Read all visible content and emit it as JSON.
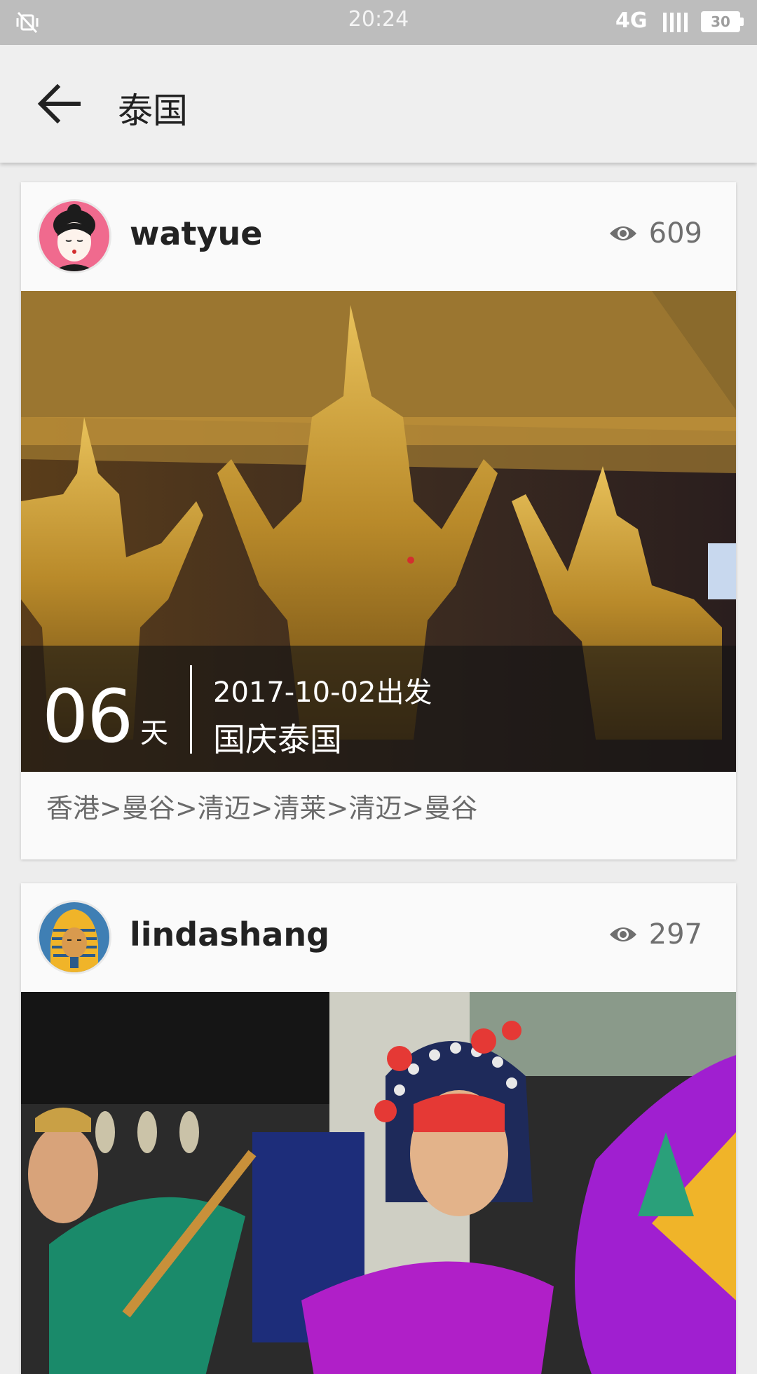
{
  "status_bar": {
    "time": "20:24",
    "network": "4G",
    "battery": "30"
  },
  "toolbar": {
    "title": "泰国"
  },
  "posts": [
    {
      "username": "watyue",
      "views": "609",
      "days": "06",
      "day_unit": "天",
      "depart": "2017-10-02出发",
      "trip_name": "国庆泰国",
      "route": "香港>曼谷>清迈>清莱>清迈>曼谷"
    },
    {
      "username": "lindashang",
      "views": "297"
    }
  ],
  "colors": {
    "status_bar": "#bdbdbd",
    "toolbar": "#efefef",
    "background": "#ededed",
    "card": "#fafafa"
  }
}
